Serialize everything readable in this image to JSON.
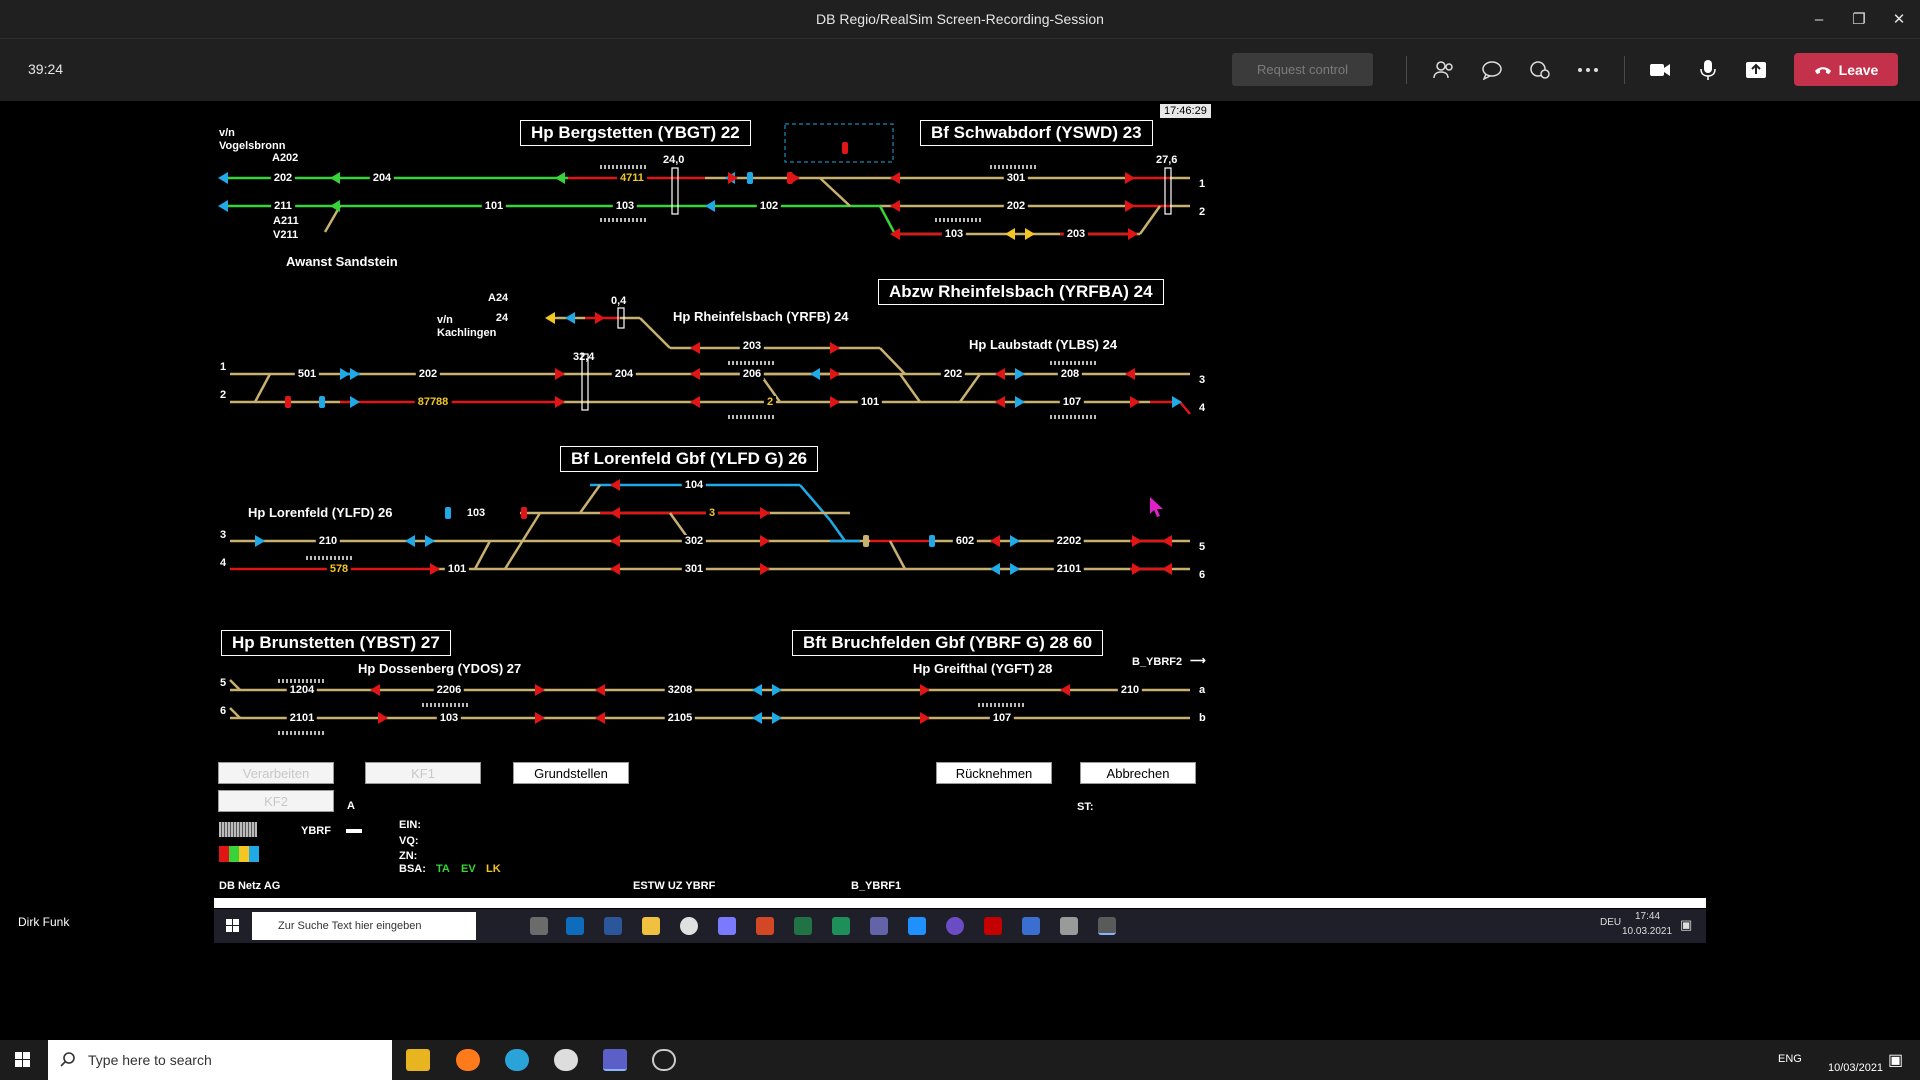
{
  "window": {
    "title": "DB Regio/RealSim Screen-Recording-Session"
  },
  "meeting": {
    "timer": "39:24",
    "request_control": "Request control",
    "leave": "Leave",
    "presenter": "Dirk Funk",
    "colors": {
      "leave": "#c4314b",
      "bar": "#202020"
    }
  },
  "screen": {
    "timestamp": "17:46:29",
    "stations": {
      "ybgt": "Hp Bergstetten  (YBGT)  22",
      "yswd": "Bf Schwabdorf  (YSWD)  23",
      "yrfba": "Abzw Rheinfelsbach  (YRFBA)  24",
      "ylfdg": "Bf Lorenfeld Gbf  (YLFD G)  26",
      "ybst": "Hp Brunstetten  (YBST)  27",
      "ybrfg": "Bft Bruchfelden Gbf  (YBRF G)  28  60"
    },
    "labels": {
      "vn": "v/n",
      "vogelsbronn": "Vogelsbronn",
      "a202": "A202",
      "a211": "A211",
      "v211": "V211",
      "awanst": "Awanst  Sandstein",
      "a24": "A24",
      "kachlingen": "Kachlingen",
      "yrfb": "Hp Rheinfelsbach  (YRFB)  24",
      "ylbs": "Hp Laubstadt  (YLBS)  24",
      "ylfd": "Hp Lorenfeld  (YLFD)  26",
      "ydos": "Hp Dossenberg  (YDOS)  27",
      "ygft": "Hp Greifthal  (YGFT)  28",
      "b_ybrf2": "B_YBRF2",
      "km_240": "24,0",
      "km_276": "27,6",
      "km_04": "0,4",
      "km_324": "32,4"
    },
    "sections": {
      "s202": "202",
      "s204": "204",
      "s4711": "4711",
      "s301": "301",
      "s211": "211",
      "s101": "101",
      "s103": "103",
      "s102": "102",
      "s202b": "202",
      "s103b": "103",
      "s203": "203",
      "s24": "24",
      "s203c": "203",
      "s501": "501",
      "s202c": "202",
      "s204c": "204",
      "s206": "206",
      "s202d": "202",
      "s208": "208",
      "s87788": "87788",
      "s2": "2",
      "s101c": "101",
      "s107": "107",
      "s104": "104",
      "s103d": "103",
      "s3": "3",
      "s210": "210",
      "s302": "302",
      "s602": "602",
      "s2202": "2202",
      "s578": "578",
      "s101d": "101",
      "s301d": "301",
      "s2101": "2101",
      "s1204": "1204",
      "s2206": "2206",
      "s3208": "3208",
      "s210e": "210",
      "s2101e": "2101",
      "s103e": "103",
      "s2105": "2105",
      "s107e": "107"
    },
    "tracks": {
      "t1": "1",
      "t2": "2",
      "t3": "3",
      "t4": "4",
      "t5": "5",
      "t6": "6",
      "ta": "a",
      "tb": "b"
    },
    "buttons": {
      "verarbeiten": "Verarbeiten",
      "kf1": "KF1",
      "grundstellen": "Grundstellen",
      "ruecknehmen": "Rücknehmen",
      "abbrechen": "Abbrechen",
      "kf2": "KF2"
    },
    "status": {
      "a": "A",
      "st": "ST:",
      "ybrf": "YBRF",
      "ein": "EIN:",
      "vq": "VQ:",
      "zn": "ZN:",
      "bsa": "BSA:",
      "ta": "TA",
      "ev": "EV",
      "lk": "LK",
      "db_netz": "DB Netz AG",
      "estw": "ESTW UZ  YBRF",
      "b_ybrf1": "B_YBRF1"
    },
    "colors": {
      "track_clear": "#38d33a",
      "track_occupied": "#e01515",
      "track_idle": "#c8b070",
      "route_blue": "#1fa9e6",
      "yellow": "#f3c623"
    }
  },
  "inner_taskbar": {
    "search_placeholder": "Zur Suche Text hier eingeben",
    "lang": "DEU",
    "time": "17:44",
    "date": "10.03.2021"
  },
  "taskbar": {
    "search_placeholder": "Type here to search",
    "lang": "ENG",
    "date": "10/03/2021"
  }
}
